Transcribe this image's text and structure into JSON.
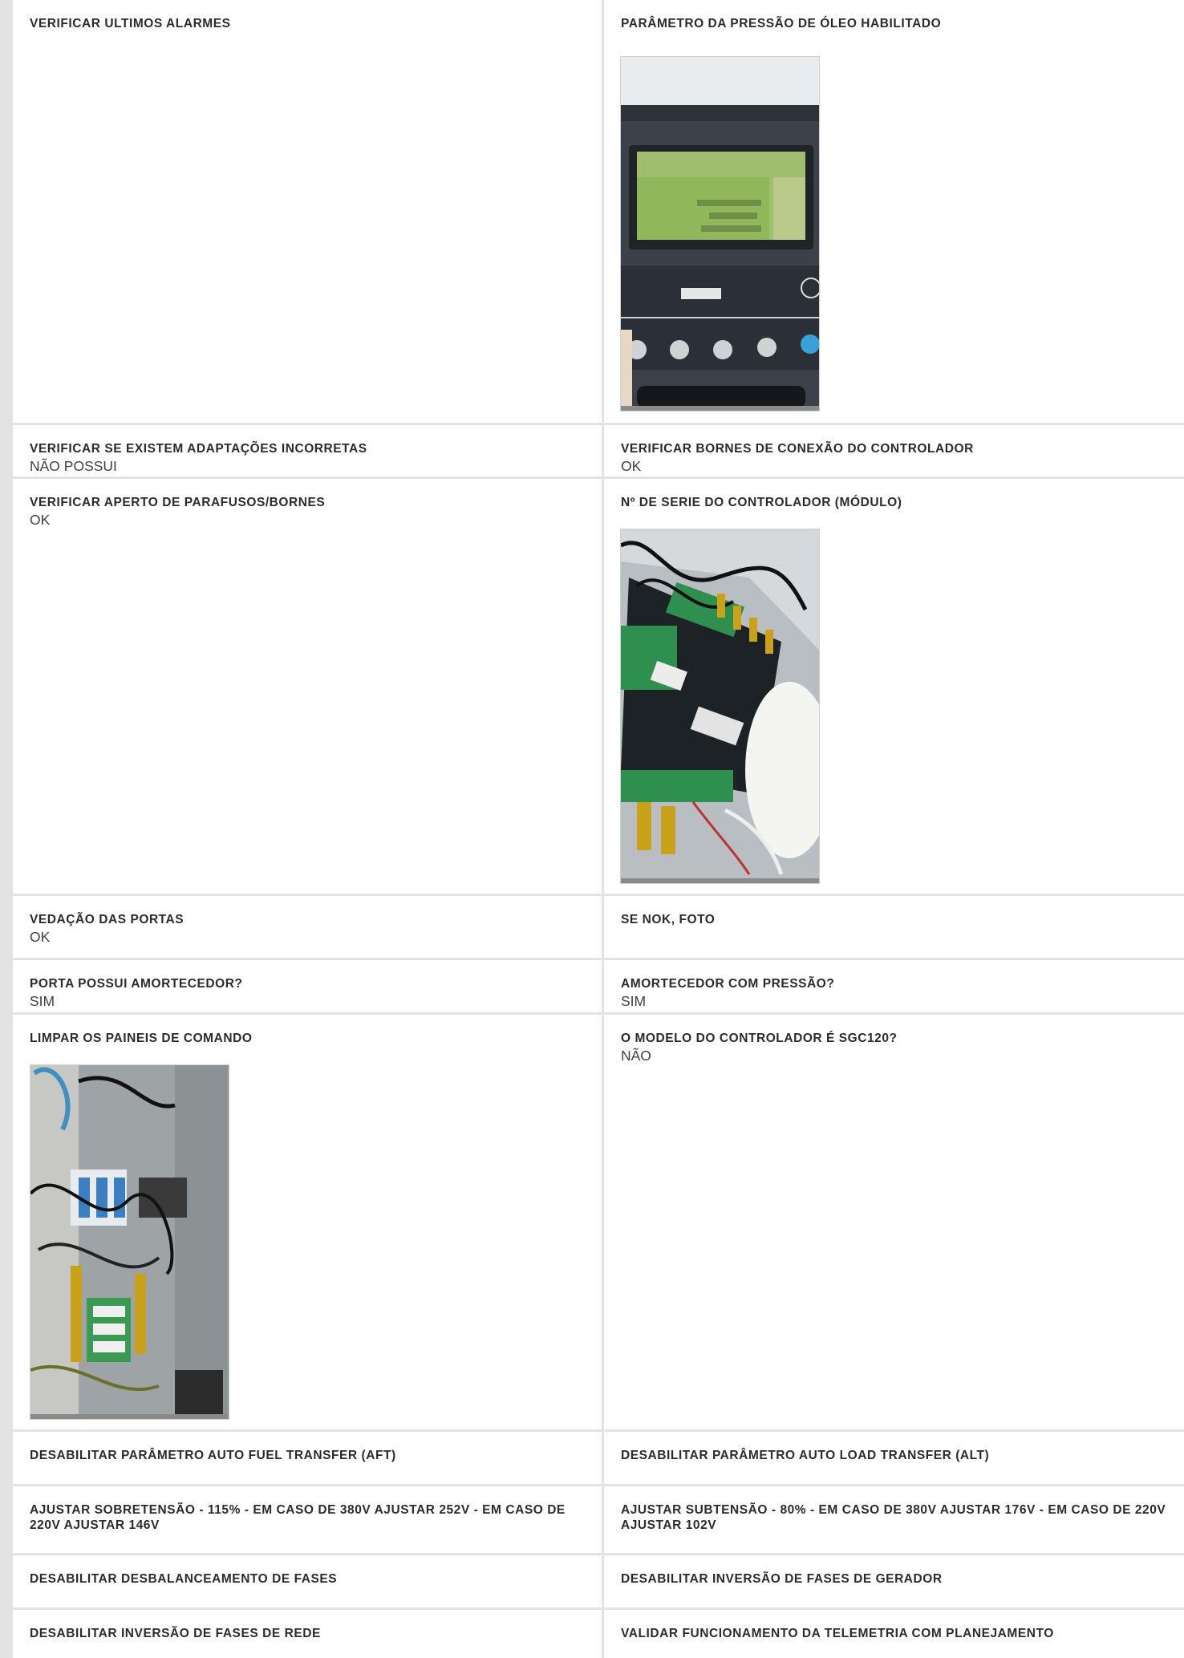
{
  "rows": [
    {
      "left": {
        "label": "VERIFICAR ULTIMOS ALARMES",
        "value": ""
      },
      "right": {
        "label": "PARÂMETRO DA PRESSÃO DE ÓLEO HABILITADO",
        "value": "",
        "photo": "controller-display-photo"
      }
    },
    {
      "left": {
        "label": "VERIFICAR SE EXISTEM ADAPTAÇÕES INCORRETAS",
        "value": "NÃO POSSUI"
      },
      "right": {
        "label": "VERIFICAR BORNES DE CONEXÃO DO CONTROLADOR",
        "value": "OK"
      }
    },
    {
      "left": {
        "label": "VERIFICAR APERTO DE PARAFUSOS/BORNES",
        "value": "OK"
      },
      "right": {
        "label": "Nº DE SERIE DO CONTROLADOR (MÓDULO)",
        "value": "",
        "photo": "controller-module-photo"
      }
    },
    {
      "left": {
        "label": "VEDAÇÃO DAS PORTAS",
        "value": "OK"
      },
      "right": {
        "label": "SE NOK, FOTO",
        "value": ""
      }
    },
    {
      "left": {
        "label": "PORTA POSSUI AMORTECEDOR?",
        "value": "SIM"
      },
      "right": {
        "label": "AMORTECEDOR COM PRESSÃO?",
        "value": "SIM"
      }
    },
    {
      "left": {
        "label": "LIMPAR OS PAINEIS DE COMANDO",
        "value": "",
        "photo": "command-panel-photo"
      },
      "right": {
        "label": "O MODELO DO CONTROLADOR É SGC120?",
        "value": "NÃO"
      }
    },
    {
      "left": {
        "label": "DESABILITAR PARÂMETRO AUTO FUEL TRANSFER (AFT)",
        "value": ""
      },
      "right": {
        "label": "DESABILITAR PARÂMETRO AUTO LOAD TRANSFER (ALT)",
        "value": ""
      }
    },
    {
      "left": {
        "label": "AJUSTAR SOBRETENSÃO - 115% - EM CASO DE 380V AJUSTAR 252V - EM CASO DE 220V AJUSTAR 146V",
        "value": ""
      },
      "right": {
        "label": "AJUSTAR SUBTENSÃO - 80% - EM CASO DE 380V AJUSTAR 176V - EM CASO DE 220V AJUSTAR 102V",
        "value": ""
      }
    },
    {
      "left": {
        "label": "DESABILITAR DESBALANCEAMENTO DE FASES",
        "value": ""
      },
      "right": {
        "label": "DESABILITAR INVERSÃO DE FASES DE GERADOR",
        "value": ""
      }
    },
    {
      "left": {
        "label": "DESABILITAR INVERSÃO DE FASES DE REDE",
        "value": ""
      },
      "right": {
        "label": "VALIDAR FUNCIONAMENTO DA TELEMETRIA COM PLANEJAMENTO",
        "value": ""
      }
    }
  ]
}
